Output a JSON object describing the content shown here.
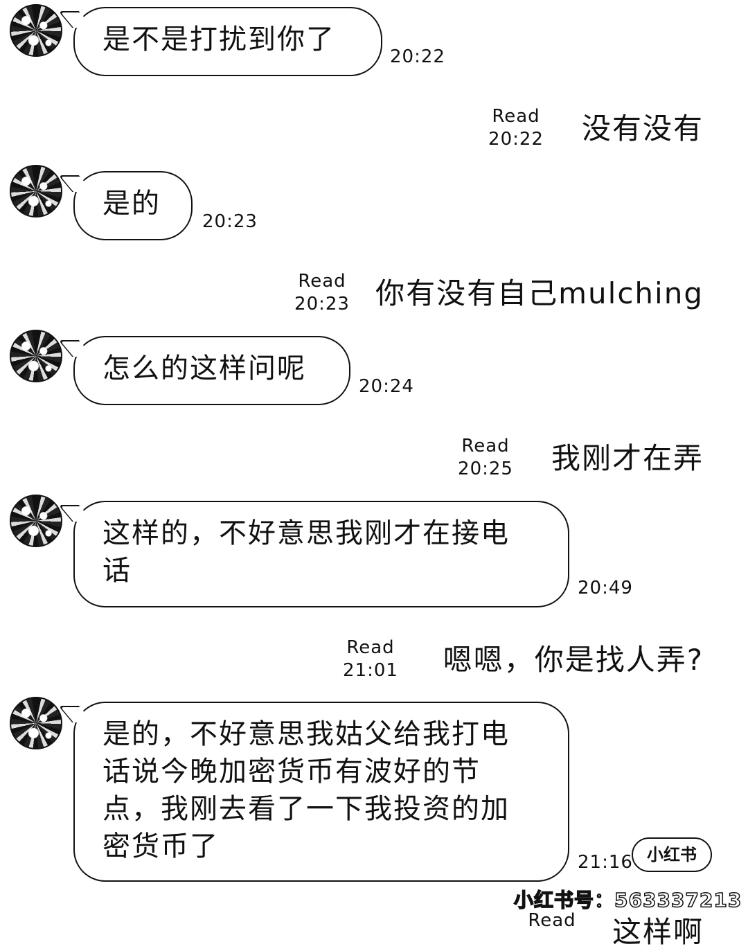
{
  "messages": [
    {
      "side": "in",
      "text": "是不是打扰到你了",
      "time": "20:22"
    },
    {
      "side": "out",
      "status": "Read",
      "time": "20:22",
      "text": "没有没有"
    },
    {
      "side": "in",
      "text": "是的",
      "time": "20:23"
    },
    {
      "side": "out",
      "status": "Read",
      "time": "20:23",
      "text": "你有没有自己mulching"
    },
    {
      "side": "in",
      "text": "怎么的这样问呢",
      "time": "20:24"
    },
    {
      "side": "out",
      "status": "Read",
      "time": "20:25",
      "text": "我刚才在弄"
    },
    {
      "side": "in",
      "line1": "这样的，不好意思我刚才在接电",
      "line2": "话",
      "time": "20:49"
    },
    {
      "side": "out",
      "status": "Read",
      "time": "21:01",
      "text": "嗯嗯，你是找人弄?"
    },
    {
      "side": "in",
      "line1": "是的，不好意思我姑父给我打电",
      "line2": "话说今晚加密货币有波好的节",
      "line3": "点，我刚去看了一下我投资的加",
      "line4": "密货币了",
      "time": "21:16"
    },
    {
      "side": "out",
      "status": "Read",
      "text": "这样啊"
    }
  ],
  "watermark": {
    "badge": "小红书",
    "id_text": "小红书号：563337213"
  }
}
